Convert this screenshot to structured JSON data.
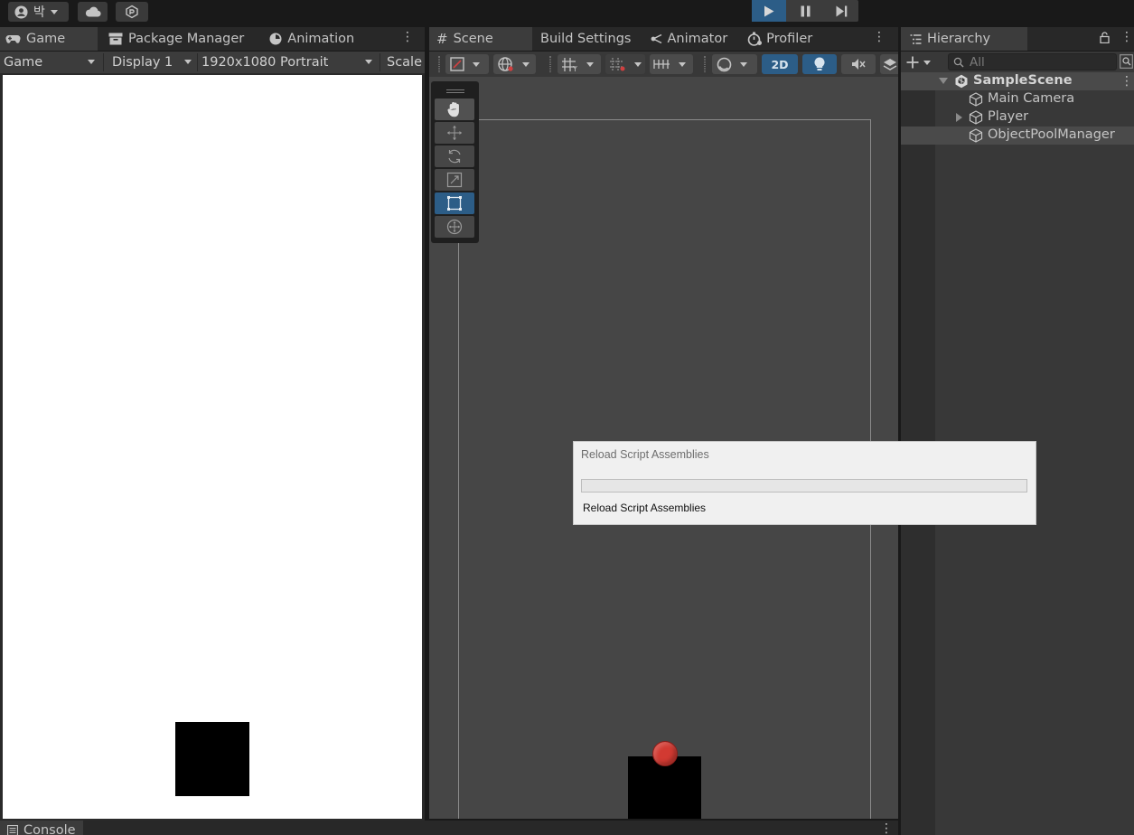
{
  "topbar": {
    "account_label": "박",
    "play_icon": "play-icon",
    "pause_icon": "pause-icon",
    "step_icon": "step-icon"
  },
  "game_panel": {
    "tabs": [
      {
        "label": "Game",
        "icon": "gamepad-icon"
      },
      {
        "label": "Package Manager",
        "icon": "package-icon"
      },
      {
        "label": "Animation",
        "icon": "animation-icon"
      }
    ],
    "toolbar": {
      "view_mode": "Game",
      "display": "Display 1",
      "resolution": "1920x1080 Portrait",
      "scale": "Scale"
    }
  },
  "scene_panel": {
    "tabs": [
      {
        "label": "Scene",
        "icon": "grid-icon"
      },
      {
        "label": "Build Settings",
        "icon": ""
      },
      {
        "label": "Animator",
        "icon": "animator-icon"
      },
      {
        "label": "Profiler",
        "icon": "profiler-icon"
      }
    ],
    "toolbar": {
      "mode_2d": "2D"
    },
    "tools": [
      "hand-tool",
      "move-tool",
      "rotate-tool",
      "scale-tool",
      "rect-tool",
      "transform-tool"
    ],
    "active_tool": "rect-tool"
  },
  "hierarchy": {
    "title": "Hierarchy",
    "search_placeholder": "All",
    "scene_name": "SampleScene",
    "items": [
      {
        "label": "Main Camera",
        "expandable": false,
        "selected": false
      },
      {
        "label": "Player",
        "expandable": true,
        "selected": false
      },
      {
        "label": "ObjectPoolManager",
        "expandable": false,
        "selected": true
      }
    ]
  },
  "console": {
    "title": "Console"
  },
  "dialog": {
    "title": "Reload Script Assemblies",
    "message": "Reload Script Assemblies",
    "progress": 0
  },
  "colors": {
    "accent": "#2c5d87",
    "player_ball": "#d23a32",
    "game_bg": "#ffffff",
    "scene_bg": "#464646"
  }
}
